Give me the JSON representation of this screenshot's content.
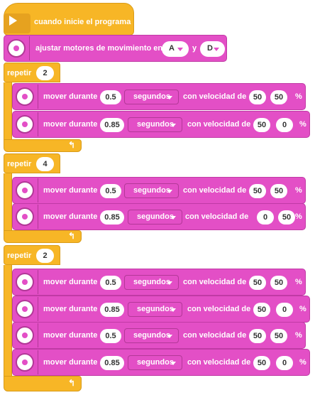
{
  "hat": {
    "label": "cuando inicie el programa"
  },
  "set_motors": {
    "label": "ajustar motores de movimiento en",
    "port1": "A",
    "conj": "y",
    "port2": "D"
  },
  "loop1": {
    "label": "repetir",
    "count": "2",
    "moves": [
      {
        "label": "mover durante",
        "value": "0.5",
        "unit": "segundos",
        "speed_label": "con velocidad de",
        "s1": "50",
        "s2": "50",
        "pct": "%"
      },
      {
        "label": "mover durante",
        "value": "0.85",
        "unit": "segundos",
        "speed_label": "con velocidad de",
        "s1": "50",
        "s2": "0",
        "pct": "%"
      }
    ]
  },
  "loop2": {
    "label": "repetir",
    "count": "4",
    "moves": [
      {
        "label": "mover durante",
        "value": "0.5",
        "unit": "segundos",
        "speed_label": "con velocidad de",
        "s1": "50",
        "s2": "50",
        "pct": "%"
      },
      {
        "label": "mover durante",
        "value": "0.85",
        "unit": "segundos",
        "speed_label": "con velocidad de",
        "s1": "0",
        "s2": "50",
        "pct": "%"
      }
    ]
  },
  "loop3": {
    "label": "repetir",
    "count": "2",
    "moves": [
      {
        "label": "mover durante",
        "value": "0.5",
        "unit": "segundos",
        "speed_label": "con velocidad de",
        "s1": "50",
        "s2": "50",
        "pct": "%"
      },
      {
        "label": "mover durante",
        "value": "0.85",
        "unit": "segundos",
        "speed_label": "con velocidad de",
        "s1": "50",
        "s2": "0",
        "pct": "%"
      },
      {
        "label": "mover durante",
        "value": "0.5",
        "unit": "segundos",
        "speed_label": "con velocidad de",
        "s1": "50",
        "s2": "50",
        "pct": "%"
      },
      {
        "label": "mover durante",
        "value": "0.85",
        "unit": "segundos",
        "speed_label": "con velocidad de",
        "s1": "50",
        "s2": "0",
        "pct": "%"
      }
    ]
  },
  "icons": {
    "hat": "play-icon",
    "motor": "motor-wheel-icon",
    "loop_end": "loop-arrow-icon"
  },
  "colors": {
    "control": "#f7b626",
    "motor": "#e34fc6"
  }
}
